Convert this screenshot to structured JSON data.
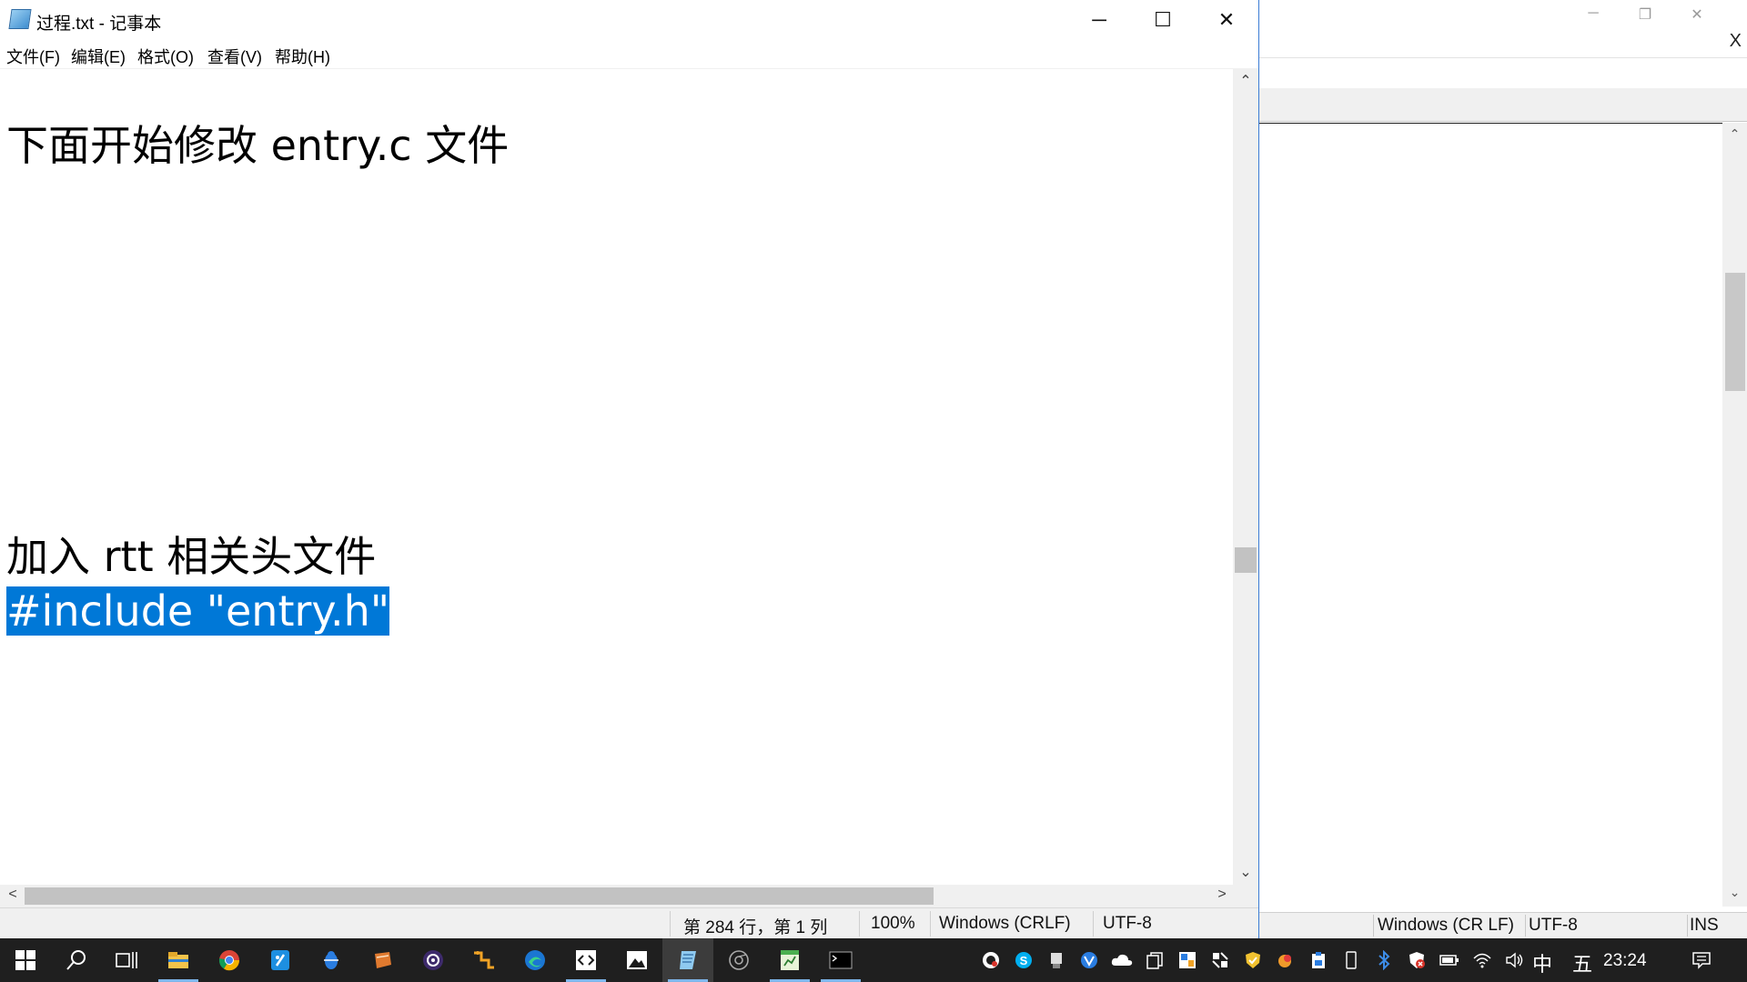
{
  "notepad": {
    "title": "过程.txt - 记事本",
    "caption": {
      "minimize": "─",
      "maximize": "☐",
      "close": "✕"
    },
    "menu": [
      "文件(F)",
      "编辑(E)",
      "格式(O)",
      "查看(V)",
      "帮助(H)"
    ],
    "editor_lines": {
      "line1": "下面开始修改 entry.c 文件",
      "line2": "加入 rtt 相关头文件",
      "line3_selected": "#include \"entry.h\""
    },
    "scroll_arrows": {
      "up": "⌃",
      "down": "⌄",
      "left": "<",
      "right": ">"
    },
    "status": {
      "position": "第 284 行，第 1 列",
      "zoom": "100%",
      "line_ending": "Windows (CRLF)",
      "encoding": "UTF-8"
    }
  },
  "background_window": {
    "caption": {
      "minimize": "─",
      "restore": "❐",
      "close": "✕"
    },
    "close_x": "X",
    "status": {
      "line_ending": "Windows (CR LF)",
      "encoding": "UTF-8",
      "mode": "INS"
    }
  },
  "taskbar": {
    "start_icon": "windows-logo-icon",
    "pinned_icons": [
      "search-icon",
      "task-view-icon",
      "file-explorer-icon",
      "chrome-icon",
      "qq-icon",
      "bug-icon",
      "scroll-app-icon",
      "obs-icon",
      "connector-icon",
      "edge-icon",
      "code-editor-icon",
      "photos-icon",
      "notepad-icon",
      "chromium-icon",
      "spreadsheet-icon",
      "terminal-icon"
    ],
    "active_app": "notepad-icon",
    "tray_icons": [
      "obs-tray-icon",
      "skype-icon",
      "usb-icon",
      "vpn-icon",
      "onedrive-icon",
      "copy-icon",
      "wechat-icon",
      "puzzle-icon",
      "shield-yellow-icon",
      "paint-icon",
      "clipboard-icon",
      "device-icon",
      "bluetooth-icon",
      "defender-icon",
      "battery-icon",
      "wifi-icon",
      "volume-icon"
    ],
    "ime_lang": "中",
    "ime_mode": "五",
    "time": "23:24",
    "notification_icon": "notification-icon"
  }
}
